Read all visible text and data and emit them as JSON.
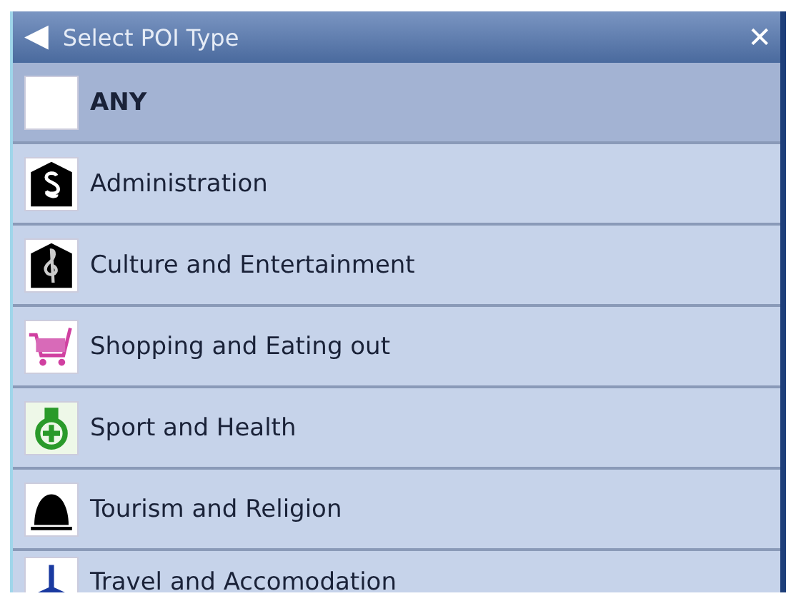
{
  "window": {
    "title": "Select POI Type",
    "back": "◀",
    "close": "✕"
  },
  "items": [
    {
      "label": "ANY",
      "selected": true
    },
    {
      "label": "Administration",
      "selected": false
    },
    {
      "label": "Culture and Entertainment",
      "selected": false
    },
    {
      "label": "Shopping and Eating out",
      "selected": false
    },
    {
      "label": "Sport and Health",
      "selected": false
    },
    {
      "label": "Tourism and Religion",
      "selected": false
    },
    {
      "label": "Travel and Accomodation",
      "selected": false
    }
  ]
}
